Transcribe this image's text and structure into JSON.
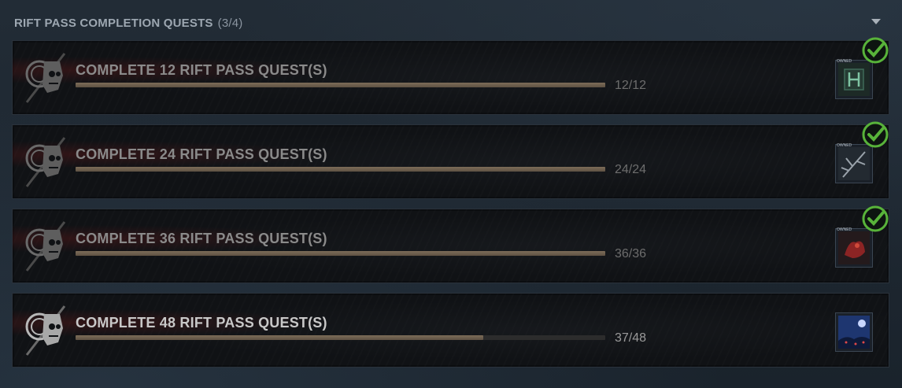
{
  "section": {
    "title": "RIFT PASS COMPLETION QUESTS",
    "count": "(3/4)"
  },
  "colors": {
    "bar_fill": "#7d6c58",
    "check_green": "#58b33a"
  },
  "quests": [
    {
      "title": "COMPLETE 12 RIFT PASS QUEST(S)",
      "progress_text": "12/12",
      "progress": 1.0,
      "completed": true,
      "reward_icon": "emerald-glyph-icon",
      "owned_label": "OWNED"
    },
    {
      "title": "COMPLETE 24 RIFT PASS QUEST(S)",
      "progress_text": "24/24",
      "progress": 1.0,
      "completed": true,
      "reward_icon": "branch-charm-icon",
      "owned_label": "OWNED"
    },
    {
      "title": "COMPLETE 36 RIFT PASS QUEST(S)",
      "progress_text": "36/36",
      "progress": 1.0,
      "completed": true,
      "reward_icon": "crimson-creature-icon",
      "owned_label": "OWNED"
    },
    {
      "title": "COMPLETE 48 RIFT PASS QUEST(S)",
      "progress_text": "37/48",
      "progress": 0.77,
      "completed": false,
      "reward_icon": "night-forest-icon",
      "owned_label": ""
    }
  ]
}
